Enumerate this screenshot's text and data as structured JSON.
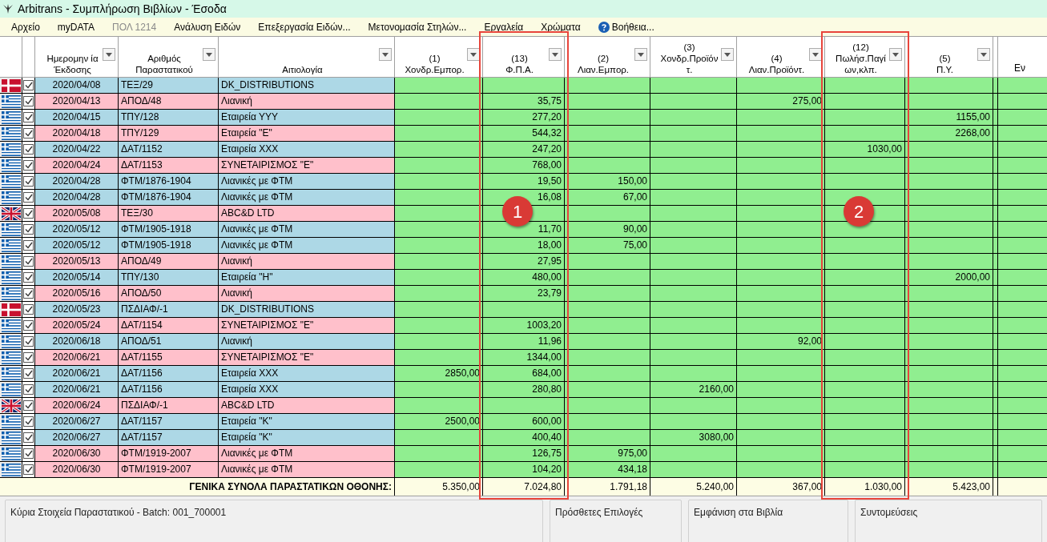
{
  "window": {
    "title": "Arbitrans - Συμπλήρωση Βιβλίων - Έσοδα"
  },
  "menu": [
    {
      "label": "Αρχείο",
      "disabled": false,
      "kind": "plain"
    },
    {
      "label": "myDATA",
      "disabled": false,
      "kind": "plain"
    },
    {
      "label": "ΠΟΛ 1214",
      "disabled": true,
      "kind": "plain"
    },
    {
      "label": "Ανάλυση Ειδών",
      "disabled": false,
      "kind": "plain"
    },
    {
      "label": "Επεξεργασία Ειδών...",
      "disabled": false,
      "kind": "plain"
    },
    {
      "label": "Μετονομασία Στηλών...",
      "disabled": false,
      "kind": "plain"
    },
    {
      "label": "Εργαλεία",
      "disabled": false,
      "kind": "plain"
    },
    {
      "label": "Χρώματα",
      "disabled": false,
      "kind": "plain"
    },
    {
      "label": "Βοήθεια...",
      "disabled": false,
      "kind": "help"
    }
  ],
  "table": {
    "text_columns": [
      {
        "lines": [
          "Ημερομην ία",
          "Έκδοσης"
        ]
      },
      {
        "lines": [
          "Αριθμός",
          "Παραστατικού"
        ]
      },
      {
        "lines": [
          "Αιτιολογία"
        ]
      }
    ],
    "amount_columns": [
      {
        "lines": [
          "(1)",
          "Χονδρ.Εμπορ."
        ]
      },
      {
        "lines": [
          "(13)",
          "Φ.Π.Α."
        ],
        "callout": "1"
      },
      {
        "lines": [
          "(2)",
          "Λιαν.Εμπορ."
        ]
      },
      {
        "lines": [
          "(3)",
          "Χονδρ.Προϊόν",
          "τ."
        ]
      },
      {
        "lines": [
          "(4)",
          "Λιαν.Προϊόντ."
        ]
      },
      {
        "lines": [
          "(12)",
          "Πωλήσ.Παγί",
          "ων,κλπ."
        ],
        "callout": "2"
      },
      {
        "lines": [
          "(5)",
          "Π.Υ."
        ]
      }
    ],
    "cut_column": {
      "lines": [
        "Εν"
      ]
    },
    "rows": [
      {
        "kind": "denmark",
        "checked": true,
        "color": "#add8e6",
        "date": "2020/04/08",
        "number": "ΤΕΞ/29",
        "description": "DK_DISTRIBUTIONS",
        "amounts": [
          {
            "kind": "empty"
          },
          {
            "kind": "empty"
          },
          {
            "kind": "empty"
          },
          {
            "kind": "empty"
          },
          {
            "kind": "empty"
          },
          {
            "kind": "empty"
          },
          {
            "kind": "empty"
          }
        ]
      },
      {
        "kind": "greece",
        "checked": true,
        "color": "#ffc0cb",
        "date": "2020/04/13",
        "number": "ΑΠΟΔ/48",
        "description": "Λιανική",
        "amounts": [
          {
            "kind": "empty"
          },
          {
            "kind": "amount",
            "value": "35,75"
          },
          {
            "kind": "empty"
          },
          {
            "kind": "empty"
          },
          {
            "kind": "amount",
            "value": "275,00"
          },
          {
            "kind": "empty"
          },
          {
            "kind": "empty"
          }
        ]
      },
      {
        "kind": "greece",
        "checked": true,
        "color": "#add8e6",
        "date": "2020/04/15",
        "number": "ΤΠΥ/128",
        "description": "Εταιρεία ΥΥΥ",
        "amounts": [
          {
            "kind": "empty"
          },
          {
            "kind": "amount",
            "value": "277,20"
          },
          {
            "kind": "empty"
          },
          {
            "kind": "empty"
          },
          {
            "kind": "empty"
          },
          {
            "kind": "empty"
          },
          {
            "kind": "amount",
            "value": "1155,00"
          }
        ]
      },
      {
        "kind": "greece",
        "checked": true,
        "color": "#ffc0cb",
        "date": "2020/04/18",
        "number": "ΤΠΥ/129",
        "description": "Εταιρεία \"Ε\"",
        "amounts": [
          {
            "kind": "empty"
          },
          {
            "kind": "amount",
            "value": "544,32"
          },
          {
            "kind": "empty"
          },
          {
            "kind": "empty"
          },
          {
            "kind": "empty"
          },
          {
            "kind": "empty"
          },
          {
            "kind": "amount",
            "value": "2268,00"
          }
        ]
      },
      {
        "kind": "greece",
        "checked": true,
        "color": "#add8e6",
        "date": "2020/04/22",
        "number": "ΔΑΤ/1152",
        "description": "Εταιρεία ΧΧΧ",
        "amounts": [
          {
            "kind": "empty"
          },
          {
            "kind": "amount",
            "value": "247,20"
          },
          {
            "kind": "empty"
          },
          {
            "kind": "empty"
          },
          {
            "kind": "empty"
          },
          {
            "kind": "amount",
            "value": "1030,00"
          },
          {
            "kind": "empty"
          }
        ]
      },
      {
        "kind": "greece",
        "checked": true,
        "color": "#ffc0cb",
        "date": "2020/04/24",
        "number": "ΔΑΤ/1153",
        "description": "ΣΥΝΕΤΑΙΡΙΣΜΟΣ \"Ε\"",
        "amounts": [
          {
            "kind": "empty"
          },
          {
            "kind": "amount",
            "value": "768,00"
          },
          {
            "kind": "empty"
          },
          {
            "kind": "empty"
          },
          {
            "kind": "empty"
          },
          {
            "kind": "empty"
          },
          {
            "kind": "empty"
          }
        ]
      },
      {
        "kind": "greece",
        "checked": true,
        "color": "#add8e6",
        "date": "2020/04/28",
        "number": "ΦΤΜ/1876-1904",
        "description": "Λιανικές με ΦΤΜ",
        "amounts": [
          {
            "kind": "empty"
          },
          {
            "kind": "amount",
            "value": "19,50"
          },
          {
            "kind": "amount",
            "value": "150,00"
          },
          {
            "kind": "empty"
          },
          {
            "kind": "empty"
          },
          {
            "kind": "empty"
          },
          {
            "kind": "empty"
          }
        ]
      },
      {
        "kind": "greece",
        "checked": true,
        "color": "#add8e6",
        "date": "2020/04/28",
        "number": "ΦΤΜ/1876-1904",
        "description": "Λιανικές με ΦΤΜ",
        "amounts": [
          {
            "kind": "empty"
          },
          {
            "kind": "amount",
            "value": "16,08"
          },
          {
            "kind": "amount",
            "value": "67,00"
          },
          {
            "kind": "empty"
          },
          {
            "kind": "empty"
          },
          {
            "kind": "empty"
          },
          {
            "kind": "empty"
          }
        ]
      },
      {
        "kind": "britain",
        "checked": true,
        "color": "#ffc0cb",
        "date": "2020/05/08",
        "number": "ΤΕΞ/30",
        "description": "ABC&D LTD",
        "amounts": [
          {
            "kind": "empty"
          },
          {
            "kind": "empty"
          },
          {
            "kind": "empty"
          },
          {
            "kind": "empty"
          },
          {
            "kind": "empty"
          },
          {
            "kind": "empty"
          },
          {
            "kind": "empty"
          }
        ]
      },
      {
        "kind": "greece",
        "checked": true,
        "color": "#add8e6",
        "date": "2020/05/12",
        "number": "ΦΤΜ/1905-1918",
        "description": "Λιανικές με ΦΤΜ",
        "amounts": [
          {
            "kind": "empty"
          },
          {
            "kind": "amount",
            "value": "11,70"
          },
          {
            "kind": "amount",
            "value": "90,00"
          },
          {
            "kind": "empty"
          },
          {
            "kind": "empty"
          },
          {
            "kind": "empty"
          },
          {
            "kind": "empty"
          }
        ]
      },
      {
        "kind": "greece",
        "checked": true,
        "color": "#add8e6",
        "date": "2020/05/12",
        "number": "ΦΤΜ/1905-1918",
        "description": "Λιανικές με ΦΤΜ",
        "amounts": [
          {
            "kind": "empty"
          },
          {
            "kind": "amount",
            "value": "18,00"
          },
          {
            "kind": "amount",
            "value": "75,00"
          },
          {
            "kind": "empty"
          },
          {
            "kind": "empty"
          },
          {
            "kind": "empty"
          },
          {
            "kind": "empty"
          }
        ]
      },
      {
        "kind": "greece",
        "checked": true,
        "color": "#ffc0cb",
        "date": "2020/05/13",
        "number": "ΑΠΟΔ/49",
        "description": "Λιανική",
        "amounts": [
          {
            "kind": "empty"
          },
          {
            "kind": "amount",
            "value": "27,95"
          },
          {
            "kind": "empty"
          },
          {
            "kind": "empty"
          },
          {
            "kind": "empty"
          },
          {
            "kind": "empty"
          },
          {
            "kind": "empty"
          }
        ]
      },
      {
        "kind": "greece",
        "checked": true,
        "color": "#add8e6",
        "date": "2020/05/14",
        "number": "ΤΠΥ/130",
        "description": "Εταιρεία \"Η\"",
        "amounts": [
          {
            "kind": "empty"
          },
          {
            "kind": "amount",
            "value": "480,00"
          },
          {
            "kind": "empty"
          },
          {
            "kind": "empty"
          },
          {
            "kind": "empty"
          },
          {
            "kind": "empty"
          },
          {
            "kind": "amount",
            "value": "2000,00"
          }
        ]
      },
      {
        "kind": "greece",
        "checked": true,
        "color": "#ffc0cb",
        "date": "2020/05/16",
        "number": "ΑΠΟΔ/50",
        "description": "Λιανική",
        "amounts": [
          {
            "kind": "empty"
          },
          {
            "kind": "amount",
            "value": "23,79"
          },
          {
            "kind": "empty"
          },
          {
            "kind": "empty"
          },
          {
            "kind": "empty"
          },
          {
            "kind": "empty"
          },
          {
            "kind": "empty"
          }
        ]
      },
      {
        "kind": "denmark",
        "checked": true,
        "color": "#add8e6",
        "date": "2020/05/23",
        "number": "ΠΣΔΙΑΦ/-1",
        "description": "DK_DISTRIBUTIONS",
        "amounts": [
          {
            "kind": "empty"
          },
          {
            "kind": "empty"
          },
          {
            "kind": "empty"
          },
          {
            "kind": "empty"
          },
          {
            "kind": "empty"
          },
          {
            "kind": "empty"
          },
          {
            "kind": "empty"
          }
        ]
      },
      {
        "kind": "greece",
        "checked": true,
        "color": "#ffc0cb",
        "date": "2020/05/24",
        "number": "ΔΑΤ/1154",
        "description": "ΣΥΝΕΤΑΙΡΙΣΜΟΣ \"Ε\"",
        "amounts": [
          {
            "kind": "empty"
          },
          {
            "kind": "amount",
            "value": "1003,20"
          },
          {
            "kind": "empty"
          },
          {
            "kind": "empty"
          },
          {
            "kind": "empty"
          },
          {
            "kind": "empty"
          },
          {
            "kind": "empty"
          }
        ]
      },
      {
        "kind": "greece",
        "checked": true,
        "color": "#add8e6",
        "date": "2020/06/18",
        "number": "ΑΠΟΔ/51",
        "description": "Λιανική",
        "amounts": [
          {
            "kind": "empty"
          },
          {
            "kind": "amount",
            "value": "11,96"
          },
          {
            "kind": "empty"
          },
          {
            "kind": "empty"
          },
          {
            "kind": "amount",
            "value": "92,00"
          },
          {
            "kind": "empty"
          },
          {
            "kind": "empty"
          }
        ]
      },
      {
        "kind": "greece",
        "checked": true,
        "color": "#ffc0cb",
        "date": "2020/06/21",
        "number": "ΔΑΤ/1155",
        "description": "ΣΥΝΕΤΑΙΡΙΣΜΟΣ \"Ε\"",
        "amounts": [
          {
            "kind": "empty"
          },
          {
            "kind": "amount",
            "value": "1344,00"
          },
          {
            "kind": "empty"
          },
          {
            "kind": "empty"
          },
          {
            "kind": "empty"
          },
          {
            "kind": "empty"
          },
          {
            "kind": "empty"
          }
        ]
      },
      {
        "kind": "greece",
        "checked": true,
        "color": "#add8e6",
        "date": "2020/06/21",
        "number": "ΔΑΤ/1156",
        "description": "Εταιρεία ΧΧΧ",
        "amounts": [
          {
            "kind": "amount",
            "value": "2850,00"
          },
          {
            "kind": "amount",
            "value": "684,00"
          },
          {
            "kind": "empty"
          },
          {
            "kind": "empty"
          },
          {
            "kind": "empty"
          },
          {
            "kind": "empty"
          },
          {
            "kind": "empty"
          }
        ]
      },
      {
        "kind": "greece",
        "checked": true,
        "color": "#add8e6",
        "date": "2020/06/21",
        "number": "ΔΑΤ/1156",
        "description": "Εταιρεία ΧΧΧ",
        "amounts": [
          {
            "kind": "empty"
          },
          {
            "kind": "amount",
            "value": "280,80"
          },
          {
            "kind": "empty"
          },
          {
            "kind": "amount",
            "value": "2160,00"
          },
          {
            "kind": "empty"
          },
          {
            "kind": "empty"
          },
          {
            "kind": "empty"
          }
        ]
      },
      {
        "kind": "britain",
        "checked": true,
        "color": "#ffc0cb",
        "date": "2020/06/24",
        "number": "ΠΣΔΙΑΦ/-1",
        "description": "ABC&D LTD",
        "amounts": [
          {
            "kind": "empty"
          },
          {
            "kind": "empty"
          },
          {
            "kind": "empty"
          },
          {
            "kind": "empty"
          },
          {
            "kind": "empty"
          },
          {
            "kind": "empty"
          },
          {
            "kind": "empty"
          }
        ]
      },
      {
        "kind": "greece",
        "checked": true,
        "color": "#add8e6",
        "date": "2020/06/27",
        "number": "ΔΑΤ/1157",
        "description": "Εταιρεία \"Κ\"",
        "amounts": [
          {
            "kind": "amount",
            "value": "2500,00"
          },
          {
            "kind": "amount",
            "value": "600,00"
          },
          {
            "kind": "empty"
          },
          {
            "kind": "empty"
          },
          {
            "kind": "empty"
          },
          {
            "kind": "empty"
          },
          {
            "kind": "empty"
          }
        ]
      },
      {
        "kind": "greece",
        "checked": true,
        "color": "#add8e6",
        "date": "2020/06/27",
        "number": "ΔΑΤ/1157",
        "description": "Εταιρεία \"Κ\"",
        "amounts": [
          {
            "kind": "empty"
          },
          {
            "kind": "amount",
            "value": "400,40"
          },
          {
            "kind": "empty"
          },
          {
            "kind": "amount",
            "value": "3080,00"
          },
          {
            "kind": "empty"
          },
          {
            "kind": "empty"
          },
          {
            "kind": "empty"
          }
        ]
      },
      {
        "kind": "greece",
        "checked": true,
        "color": "#ffc0cb",
        "date": "2020/06/30",
        "number": "ΦΤΜ/1919-2007",
        "description": "Λιανικές με ΦΤΜ",
        "amounts": [
          {
            "kind": "empty"
          },
          {
            "kind": "amount",
            "value": "126,75"
          },
          {
            "kind": "amount",
            "value": "975,00"
          },
          {
            "kind": "empty"
          },
          {
            "kind": "empty"
          },
          {
            "kind": "empty"
          },
          {
            "kind": "empty"
          }
        ]
      },
      {
        "kind": "greece",
        "checked": true,
        "color": "#ffc0cb",
        "date": "2020/06/30",
        "number": "ΦΤΜ/1919-2007",
        "description": "Λιανικές με ΦΤΜ",
        "amounts": [
          {
            "kind": "empty"
          },
          {
            "kind": "amount",
            "value": "104,20"
          },
          {
            "kind": "amount",
            "value": "434,18"
          },
          {
            "kind": "empty"
          },
          {
            "kind": "empty"
          },
          {
            "kind": "empty"
          },
          {
            "kind": "empty"
          }
        ]
      }
    ],
    "totals": {
      "label": "ΓΕΝΙΚΑ ΣΥΝΟΛΑ ΠΑΡΑΣΤΑΤΙΚΩΝ ΟΘΟΝΗΣ:",
      "amounts": [
        "5.350,00",
        "7.024,80",
        "1.791,18",
        "5.240,00",
        "367,00",
        "1.030,00",
        "5.423,00"
      ]
    }
  },
  "panels": [
    {
      "title": "Κύρια Στοιχεία Παραστατικού - Batch: 001_700001"
    },
    {
      "title": "Πρόσθετες Επιλογές"
    },
    {
      "title": "Εμφάνιση στα Βιβλία"
    },
    {
      "title": "Συντομεύσεις"
    }
  ]
}
